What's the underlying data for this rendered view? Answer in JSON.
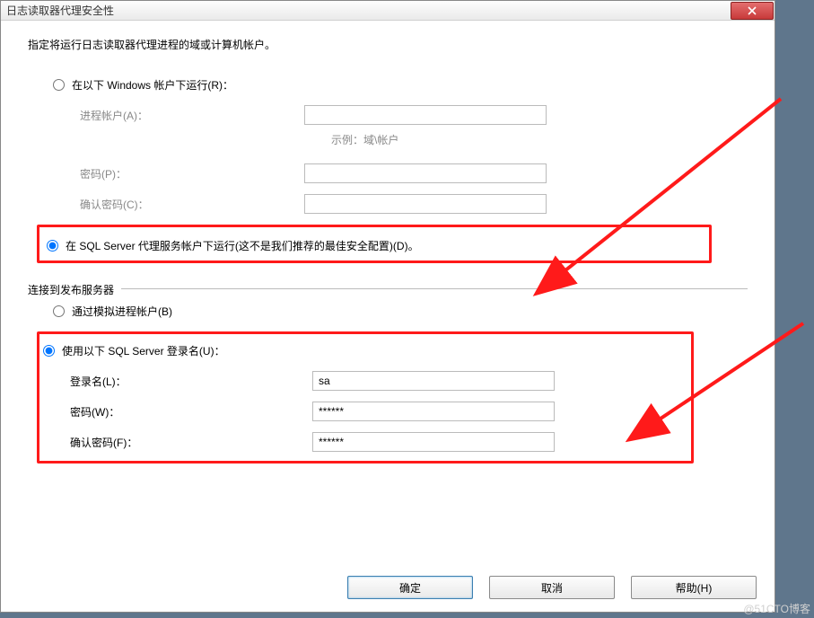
{
  "window": {
    "title": "日志读取器代理安全性"
  },
  "instruction": "指定将运行日志读取器代理进程的域或计算机帐户。",
  "runSection": {
    "radioWindows": "在以下 Windows 帐户下运行(R)：",
    "processAccountLabel": "进程帐户(A)：",
    "exampleHint": "示例：域\\帐户",
    "passwordLabel": "密码(P)：",
    "confirmPasswordLabel": "确认密码(C)：",
    "radioSqlAgent": "在 SQL Server 代理服务帐户下运行(这不是我们推荐的最佳安全配置)(D)。"
  },
  "connectSection": {
    "legend": "连接到发布服务器",
    "radioImpersonate": "通过模拟进程帐户(B)",
    "radioSqlLogin": "使用以下 SQL Server 登录名(U)：",
    "loginLabel": "登录名(L)：",
    "loginValue": "sa",
    "passwordLabel": "密码(W)：",
    "passwordValue": "******",
    "confirmLabel": "确认密码(F)：",
    "confirmValue": "******"
  },
  "buttons": {
    "ok": "确定",
    "cancel": "取消",
    "help": "帮助(H)"
  },
  "watermark": "@51CTO博客"
}
